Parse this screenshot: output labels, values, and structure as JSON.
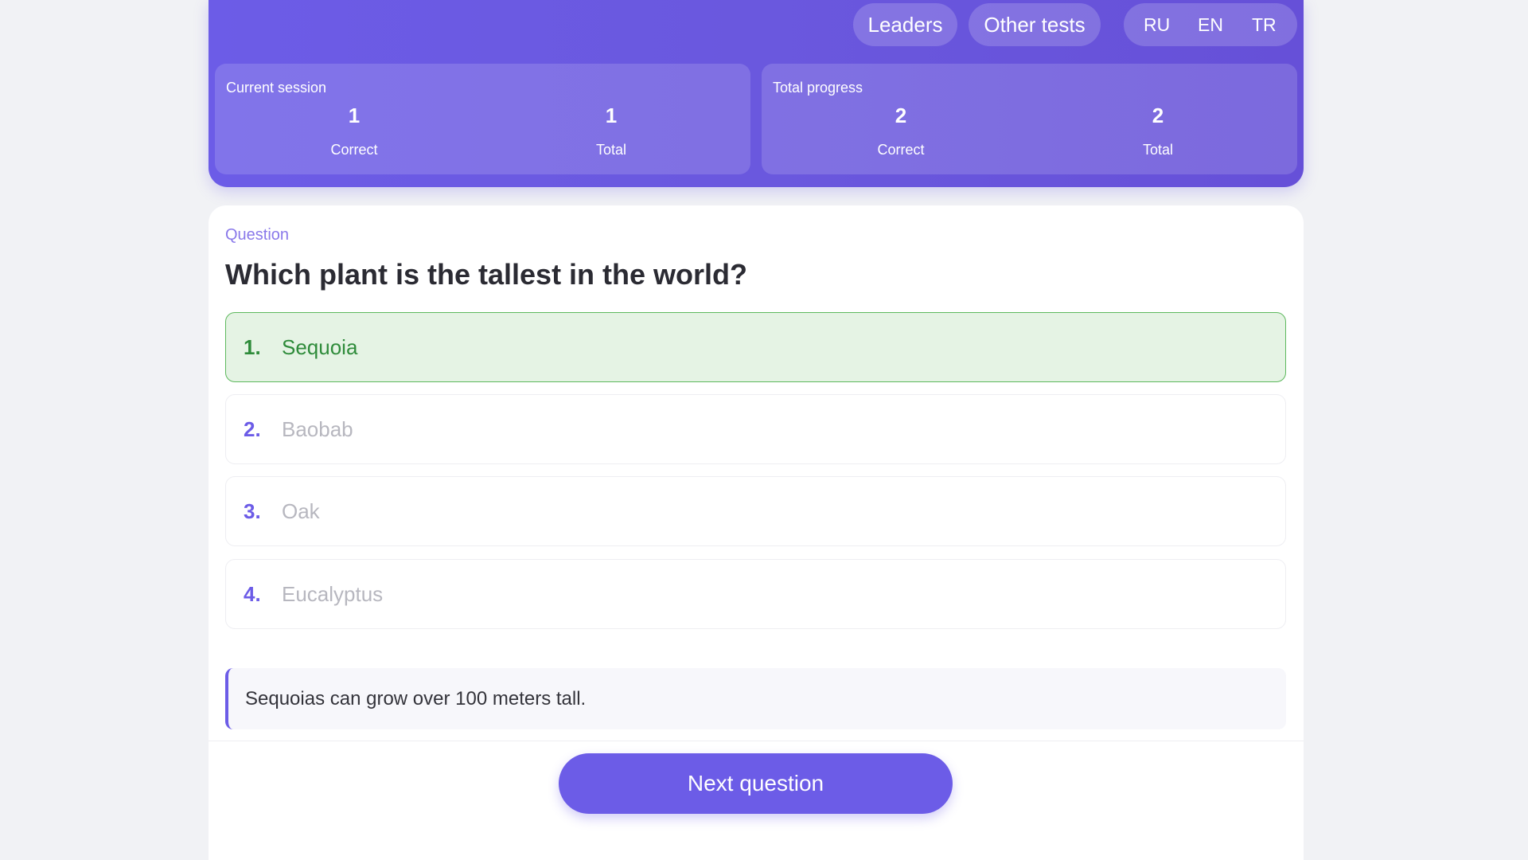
{
  "nav": {
    "leaders": "Leaders",
    "other_tests": "Other tests",
    "languages": [
      "RU",
      "EN",
      "TR"
    ]
  },
  "stats": {
    "current_session": {
      "title": "Current session",
      "correct_value": "1",
      "correct_label": "Correct",
      "total_value": "1",
      "total_label": "Total"
    },
    "total_progress": {
      "title": "Total progress",
      "correct_value": "2",
      "correct_label": "Correct",
      "total_value": "2",
      "total_label": "Total"
    }
  },
  "question": {
    "label": "Question",
    "text": "Which plant is the tallest in the world?",
    "options": [
      {
        "num": "1.",
        "text": "Sequoia",
        "state": "correct"
      },
      {
        "num": "2.",
        "text": "Baobab",
        "state": "disabled"
      },
      {
        "num": "3.",
        "text": "Oak",
        "state": "disabled"
      },
      {
        "num": "4.",
        "text": "Eucalyptus",
        "state": "disabled"
      }
    ],
    "explanation": "Sequoias can grow over 100 meters tall."
  },
  "actions": {
    "next": "Next question"
  },
  "colors": {
    "accent": "#6c5ce7",
    "correct_bg": "#e5f3e4",
    "correct_border": "#5cb85c",
    "correct_text": "#2e8b3a"
  }
}
